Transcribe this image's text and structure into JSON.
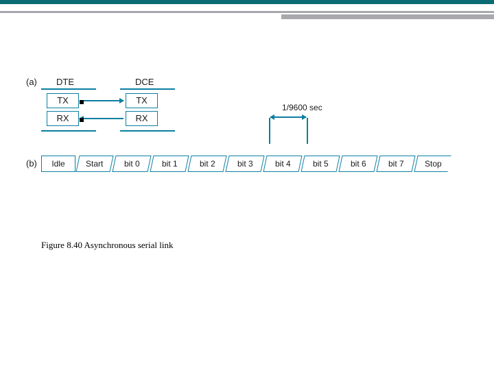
{
  "figure": {
    "caption": "Figure 8.40 Asynchronous serial link",
    "part_a": {
      "label": "(a)",
      "left_header": "DTE",
      "right_header": "DCE",
      "rows": [
        "TX",
        "RX"
      ]
    },
    "part_b": {
      "label": "(b)",
      "time_label": "1/9600 sec",
      "segments": [
        "Idle",
        "Start",
        "bit 0",
        "bit 1",
        "bit 2",
        "bit 3",
        "bit 4",
        "bit 5",
        "bit 6",
        "bit 7",
        "Stop"
      ]
    }
  }
}
